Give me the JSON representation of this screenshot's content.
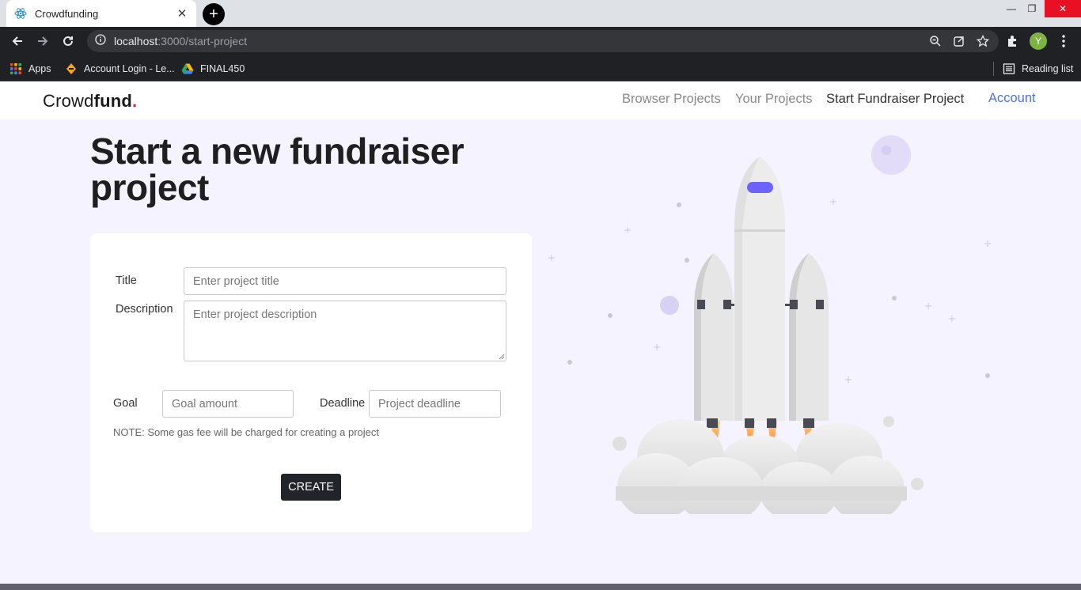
{
  "browser": {
    "tab_title": "Crowdfunding",
    "url_host": "localhost",
    "url_path": ":3000/start-project",
    "profile_initial": "Y",
    "bookmarks": [
      {
        "label": "Apps",
        "icon": "apps-grid-icon"
      },
      {
        "label": "Account Login - Le...",
        "icon": "account-login-favicon-icon"
      },
      {
        "label": "FINAL450",
        "icon": "google-drive-icon"
      }
    ],
    "reading_list": "Reading list"
  },
  "nav": {
    "brand_light": "Crowd",
    "brand_bold": "fund",
    "brand_dot": ".",
    "links": [
      "Browser Projects",
      "Your Projects",
      "Start Fundraiser Project"
    ],
    "account": "Account"
  },
  "page": {
    "title": "Start a new fundraiser project"
  },
  "form": {
    "title_label": "Title",
    "title_placeholder": "Enter project title",
    "description_label": "Description",
    "description_placeholder": "Enter project description",
    "goal_label": "Goal",
    "goal_placeholder": "Goal amount",
    "deadline_label": "Deadline",
    "deadline_placeholder": "Project deadline",
    "note": "NOTE: Some gas fee will be charged for creating a project",
    "submit": "CREATE"
  },
  "colors": {
    "accent_link": "#4f72e8",
    "brand_dot": "#e11d48",
    "button_bg": "#212529",
    "page_bg": "#f5f3ff"
  }
}
